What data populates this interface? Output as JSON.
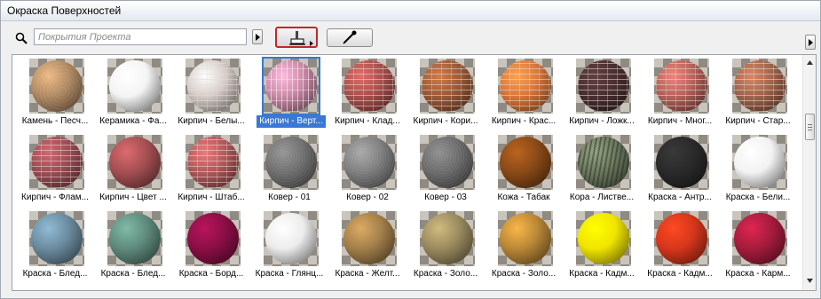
{
  "window": {
    "title": "Окраска Поверхностей"
  },
  "search": {
    "placeholder": "Покрытия Проекта"
  },
  "icons": {
    "search": "magnifier-icon",
    "paint_bucket": "paint-bucket-icon",
    "eyedropper": "eyedropper-icon",
    "arrow": "triangle-right-icon"
  },
  "colors": {
    "selection": "#3a78d4",
    "active_tool_border": "#c0272d"
  },
  "materials": [
    {
      "label": "Камень - Песч...",
      "color": "#b08a63",
      "style": "stone",
      "selected": false
    },
    {
      "label": "Керамика - Фа...",
      "color": "#f4f4f4",
      "style": "plain",
      "selected": false
    },
    {
      "label": "Кирпич - Белы...",
      "color": "#d6ccc8",
      "style": "brick-light",
      "selected": false
    },
    {
      "label": "Кирпич - Верт...",
      "color": "#c98aa5",
      "style": "brick-vert",
      "selected": true
    },
    {
      "label": "Кирпич - Клад...",
      "color": "#a9504d",
      "style": "brick",
      "selected": false
    },
    {
      "label": "Кирпич - Кори...",
      "color": "#9c5a36",
      "style": "brick",
      "selected": false
    },
    {
      "label": "Кирпич - Крас...",
      "color": "#d9773a",
      "style": "brick",
      "selected": false
    },
    {
      "label": "Кирпич - Ложк...",
      "color": "#4a2f30",
      "style": "brick",
      "selected": false
    },
    {
      "label": "Кирпич - Мног...",
      "color": "#b5625a",
      "style": "brick",
      "selected": false
    },
    {
      "label": "Кирпич - Стар...",
      "color": "#a2644b",
      "style": "brick",
      "selected": false
    },
    {
      "label": "Кирпич - Флам...",
      "color": "#9a4d54",
      "style": "brick",
      "selected": false
    },
    {
      "label": "Кирпич - Цвет ...",
      "color": "#a44f52",
      "style": "plain",
      "selected": false
    },
    {
      "label": "Кирпич - Штаб...",
      "color": "#b0595a",
      "style": "brick",
      "selected": false
    },
    {
      "label": "Ковер - 01",
      "color": "#6e6e6e",
      "style": "noise",
      "selected": false
    },
    {
      "label": "Ковер - 02",
      "color": "#7d7d7d",
      "style": "noise",
      "selected": false
    },
    {
      "label": "Ковер - 03",
      "color": "#6a6a6a",
      "style": "noise",
      "selected": false
    },
    {
      "label": "Кожа - Табак",
      "color": "#8a4a17",
      "style": "plain",
      "selected": false
    },
    {
      "label": "Кора - Листве...",
      "color": "#6f7a62",
      "style": "bark",
      "selected": false
    },
    {
      "label": "Краска - Антр...",
      "color": "#2a2a2a",
      "style": "plain",
      "selected": false
    },
    {
      "label": "Краска - Бели...",
      "color": "#f2f2f2",
      "style": "plain",
      "selected": false
    },
    {
      "label": "Краска - Блед...",
      "color": "#6b8b9e",
      "style": "plain",
      "selected": false
    },
    {
      "label": "Краска - Блед...",
      "color": "#5f8a7c",
      "style": "plain",
      "selected": false
    },
    {
      "label": "Краска - Борд...",
      "color": "#8a0f45",
      "style": "plain",
      "selected": false
    },
    {
      "label": "Краска - Глянц...",
      "color": "#ececec",
      "style": "plain",
      "selected": false
    },
    {
      "label": "Краска - Желт...",
      "color": "#a37f4a",
      "style": "plain",
      "selected": false
    },
    {
      "label": "Краска - Золо...",
      "color": "#9a8a5e",
      "style": "plain",
      "selected": false
    },
    {
      "label": "Краска - Золо...",
      "color": "#b98736",
      "style": "plain",
      "selected": false
    },
    {
      "label": "Краска - Кадм...",
      "color": "#f0e400",
      "style": "plain",
      "selected": false
    },
    {
      "label": "Краска - Кадм...",
      "color": "#d6361b",
      "style": "plain",
      "selected": false
    },
    {
      "label": "Краска - Карм...",
      "color": "#a51c3d",
      "style": "plain",
      "selected": false
    }
  ]
}
